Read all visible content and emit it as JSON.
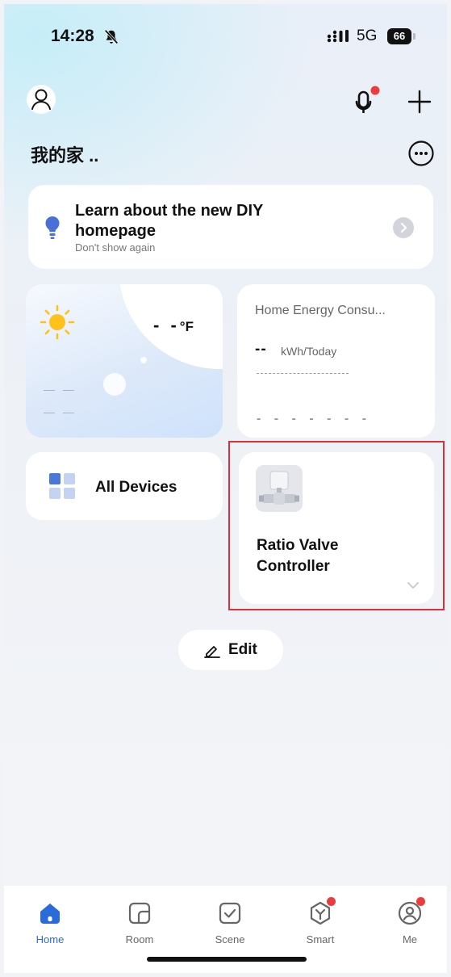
{
  "status_bar": {
    "time": "14:28",
    "network": "5G",
    "battery": "66"
  },
  "header": {
    "home_name": "我的家 .."
  },
  "tip_card": {
    "title": "Learn about the new DIY homepage",
    "dismiss": "Don't show again"
  },
  "weather": {
    "temperature": "- -",
    "unit": "°F",
    "line1": "— —",
    "line2": "— —"
  },
  "energy": {
    "title": "Home Energy Consu...",
    "value": "--",
    "unit": "kWh/Today",
    "placeholder": "- - - - - - -"
  },
  "all_devices": {
    "label": "All Devices"
  },
  "device": {
    "name": "Ratio Valve Controller"
  },
  "edit": {
    "label": "Edit"
  },
  "tabs": [
    {
      "label": "Home",
      "icon": "home-icon"
    },
    {
      "label": "Room",
      "icon": "room-icon"
    },
    {
      "label": "Scene",
      "icon": "scene-icon"
    },
    {
      "label": "Smart",
      "icon": "smart-icon"
    },
    {
      "label": "Me",
      "icon": "me-icon"
    }
  ],
  "colors": {
    "accent": "#2a6ad9",
    "badge": "#ee3b3b",
    "highlight": "#d9303a",
    "bulb": "#4a6fd8",
    "sun": "#ffc21a"
  }
}
